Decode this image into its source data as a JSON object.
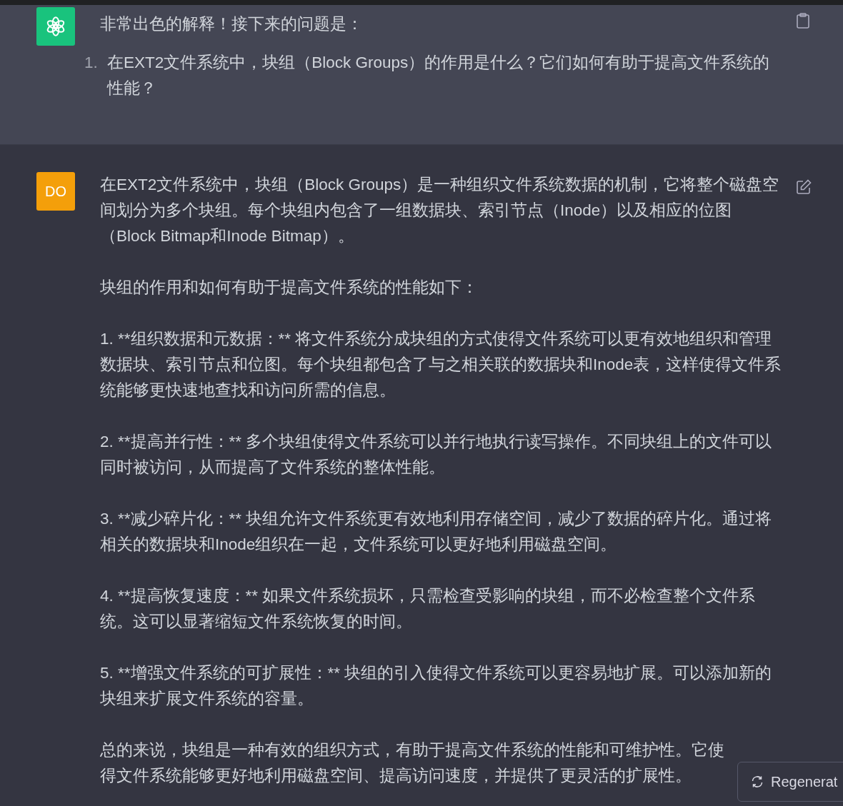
{
  "messages": [
    {
      "kind": "assistant",
      "intro": "非常出色的解释！接下来的问题是：",
      "list": [
        {
          "number": "1.",
          "text": "在EXT2文件系统中，块组（Block Groups）的作用是什么？它们如何有助于提高文件系统的性能？"
        }
      ]
    },
    {
      "kind": "user",
      "avatar": "DO",
      "paragraphs": [
        "在EXT2文件系统中，块组（Block Groups）是一种组织文件系统数据的机制，它将整个磁盘空间划分为多个块组。每个块组内包含了一组数据块、索引节点（Inode）以及相应的位图（Block Bitmap和Inode Bitmap）。",
        "块组的作用和如何有助于提高文件系统的性能如下：",
        "1. **组织数据和元数据：** 将文件系统分成块组的方式使得文件系统可以更有效地组织和管理数据块、索引节点和位图。每个块组都包含了与之相关联的数据块和Inode表，这样使得文件系统能够更快速地查找和访问所需的信息。",
        "2. **提高并行性：** 多个块组使得文件系统可以并行地执行读写操作。不同块组上的文件可以同时被访问，从而提高了文件系统的整体性能。",
        "3. **减少碎片化：** 块组允许文件系统更有效地利用存储空间，减少了数据的碎片化。通过将相关的数据块和Inode组织在一起，文件系统可以更好地利用磁盘空间。",
        "4. **提高恢复速度：** 如果文件系统损坏，只需检查受影响的块组，而不必检查整个文件系统。这可以显著缩短文件系统恢复的时间。",
        "5. **增强文件系统的可扩展性：** 块组的引入使得文件系统可以更容易地扩展。可以添加新的块组来扩展文件系统的容量。",
        "总的来说，块组是一种有效的组织方式，有助于提高文件系统的性能和可维护性。它使得文件系统能够更好地利用磁盘空间、提高访问速度，并提供了更灵活的扩展性。"
      ]
    }
  ],
  "regenerate_button": {
    "label": "Regenerat"
  }
}
